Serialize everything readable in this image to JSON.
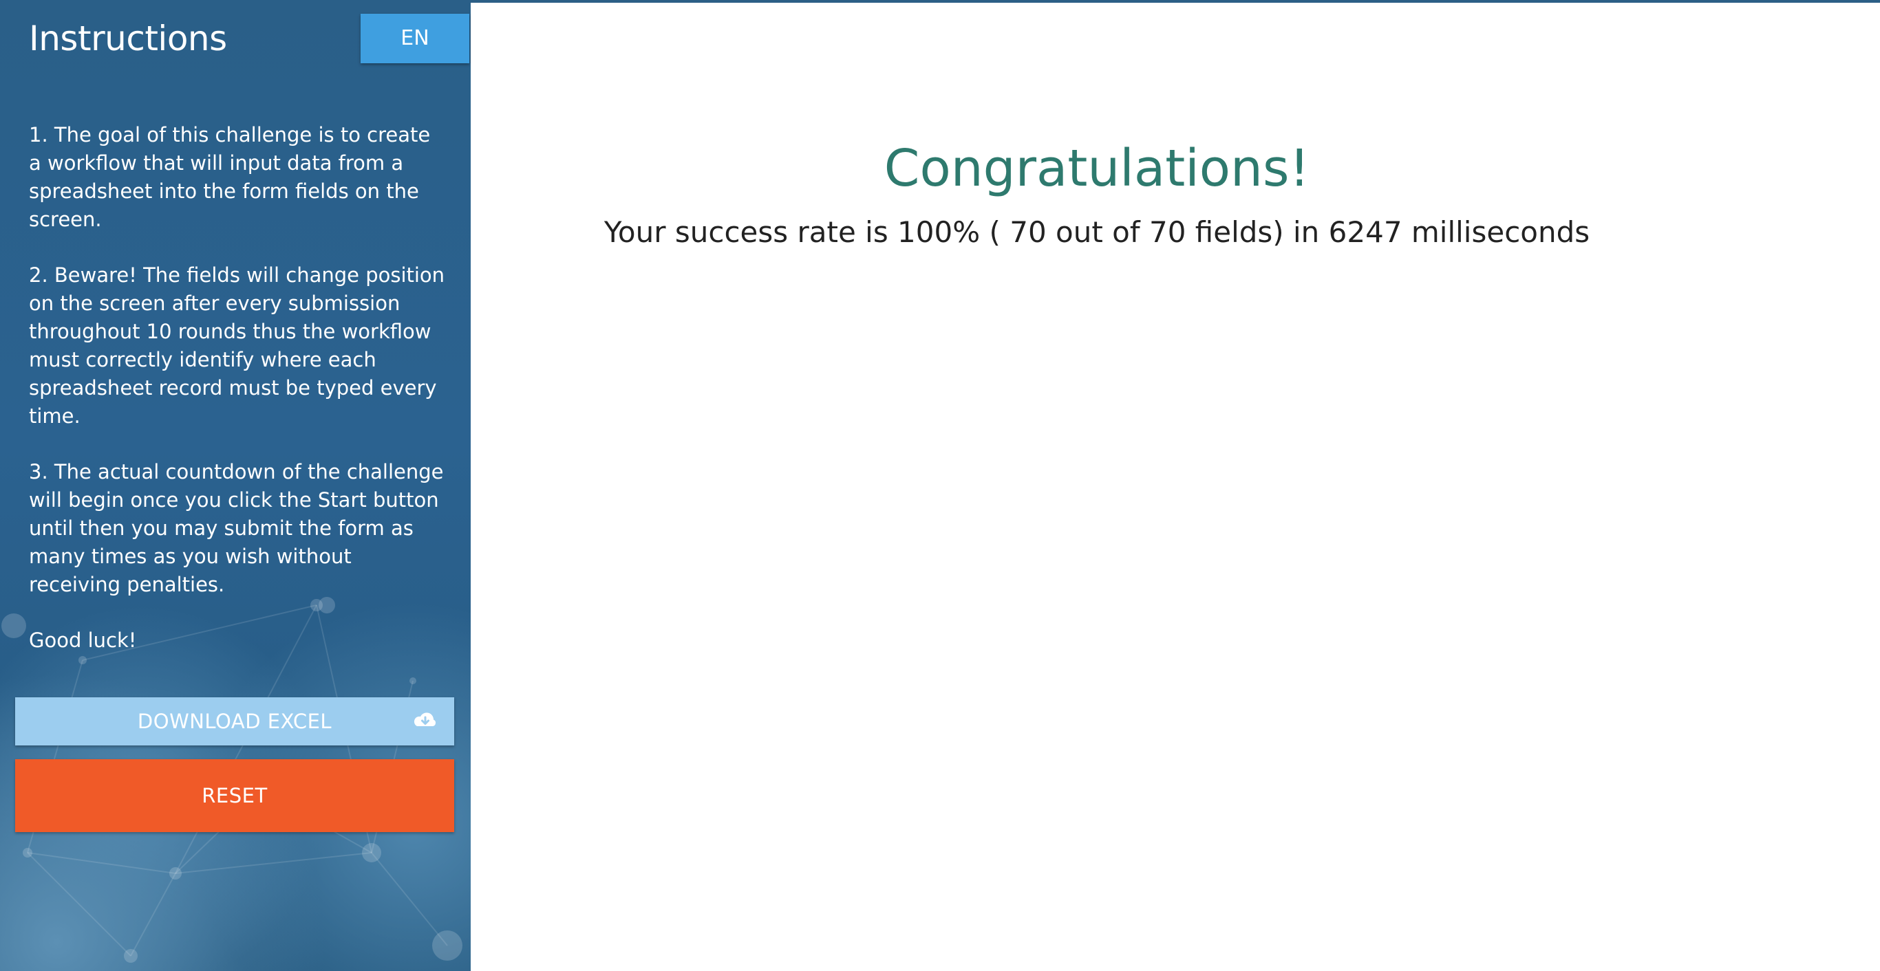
{
  "sidebar": {
    "title": "Instructions",
    "language_label": "EN",
    "instructions": [
      "1. The goal of this challenge is to create a workflow that will input data from a spreadsheet into the form fields on the screen.",
      "2. Beware! The fields will change position on the screen after every submission throughout 10 rounds thus the workflow must correctly identify where each spreadsheet record must be typed every time.",
      "3. The actual countdown of the challenge will begin once you click the Start button until then you may submit the form as many times as you wish without receiving penalties.",
      "Good luck!"
    ],
    "download_label": "DOWNLOAD EXCEL",
    "download_icon": "cloud-download-icon",
    "reset_label": "RESET"
  },
  "main": {
    "heading": "Congratulations!",
    "result_text": "Your success rate is 100% ( 70 out of 70 fields) in 6247 milliseconds"
  },
  "colors": {
    "sidebar_bg": "#2b6290",
    "lang_button": "#3f9fe0",
    "download_button": "#9ccdef",
    "reset_button": "#f05a28",
    "heading": "#2e7a6e"
  }
}
